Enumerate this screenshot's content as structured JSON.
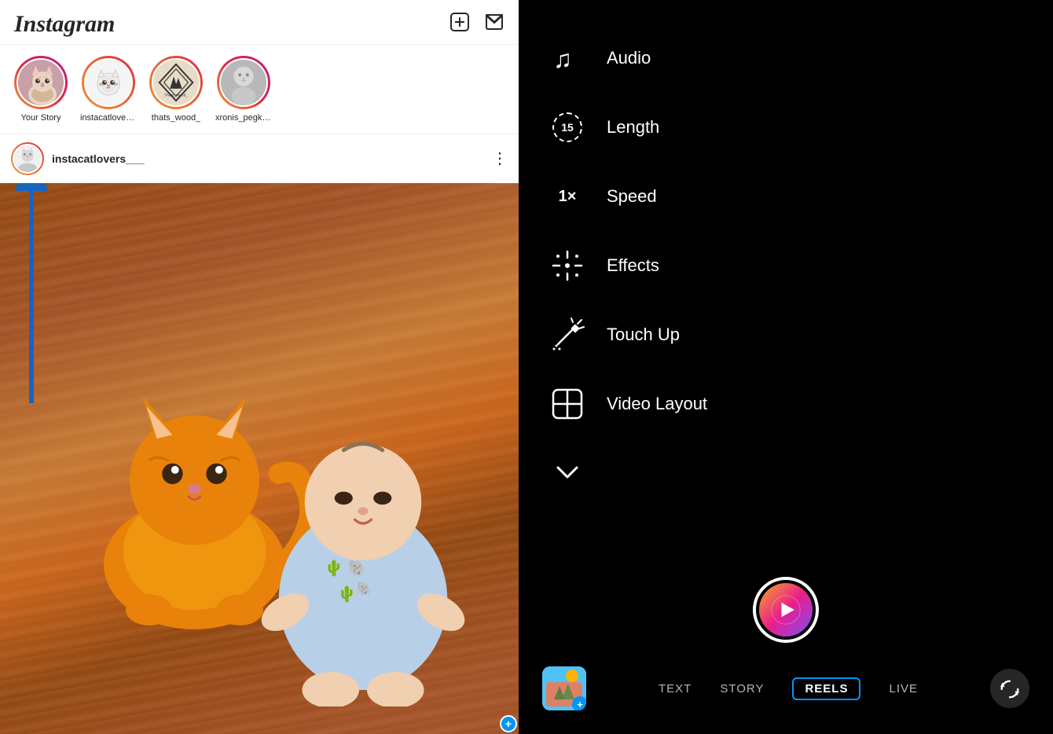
{
  "app": {
    "name": "Instagram",
    "logo": "Instagram"
  },
  "header": {
    "add_icon": "⊕",
    "dm_icon": "✈",
    "add_label": "Add post",
    "dm_label": "Direct messages"
  },
  "stories": [
    {
      "id": "your_story",
      "label": "Your Story",
      "type": "your",
      "ring": "gradient"
    },
    {
      "id": "instacatlovers",
      "label": "instacatlovers...",
      "type": "cat",
      "ring": "orange"
    },
    {
      "id": "thats_wood",
      "label": "thats_wood_",
      "type": "wood",
      "ring": "orange"
    },
    {
      "id": "xronis_pegk",
      "label": "xronis_pegk_...",
      "type": "baby",
      "ring": "gradient"
    }
  ],
  "post": {
    "username": "instacatlovers___",
    "menu_label": "⋮"
  },
  "right_panel": {
    "menu_items": [
      {
        "id": "audio",
        "label": "Audio",
        "icon": "music"
      },
      {
        "id": "length",
        "label": "Length",
        "icon": "15"
      },
      {
        "id": "speed",
        "label": "Speed",
        "icon": "1x"
      },
      {
        "id": "effects",
        "label": "Effects",
        "icon": "sparkles"
      },
      {
        "id": "touch_up",
        "label": "Touch Up",
        "icon": "wand"
      },
      {
        "id": "video_layout",
        "label": "Video Layout",
        "icon": "layout"
      },
      {
        "id": "more",
        "label": "",
        "icon": "chevron"
      }
    ],
    "modes": [
      {
        "id": "text",
        "label": "TEXT",
        "active": false
      },
      {
        "id": "story",
        "label": "STORY",
        "active": false
      },
      {
        "id": "reels",
        "label": "REELS",
        "active": true
      },
      {
        "id": "live",
        "label": "LIVE",
        "active": false
      }
    ]
  }
}
